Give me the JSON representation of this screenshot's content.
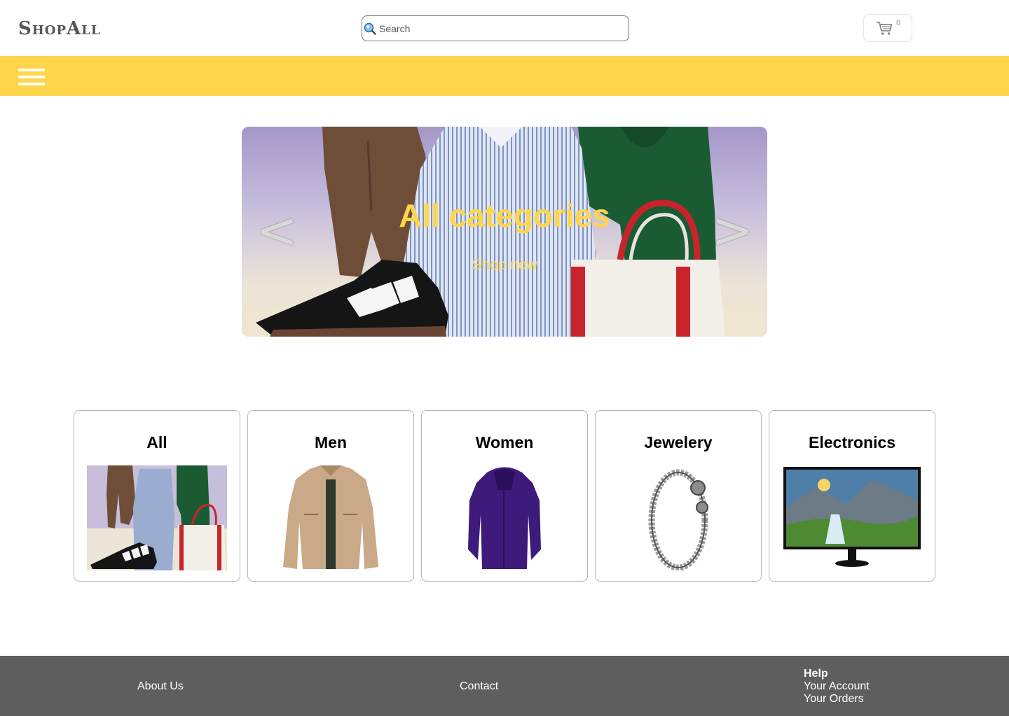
{
  "header": {
    "logo": "ShopAll",
    "search_placeholder": "Search",
    "cart_count": "0"
  },
  "banner": {
    "title": "All categories",
    "cta": "Shop now",
    "prev": "<",
    "next": ">"
  },
  "categories": [
    {
      "label": "All"
    },
    {
      "label": "Men"
    },
    {
      "label": "Women"
    },
    {
      "label": "Jewelery"
    },
    {
      "label": "Electronics"
    }
  ],
  "footer": {
    "about": "About Us",
    "contact": "Contact",
    "help": "Help",
    "account": "Your Account",
    "orders": "Your Orders"
  },
  "colors": {
    "accent": "#fed54b",
    "footer_bg": "#5e5e5e",
    "logo": "#555555"
  },
  "icons": {
    "search": "search-icon",
    "cart": "cart-icon",
    "menu": "hamburger-menu-icon"
  }
}
